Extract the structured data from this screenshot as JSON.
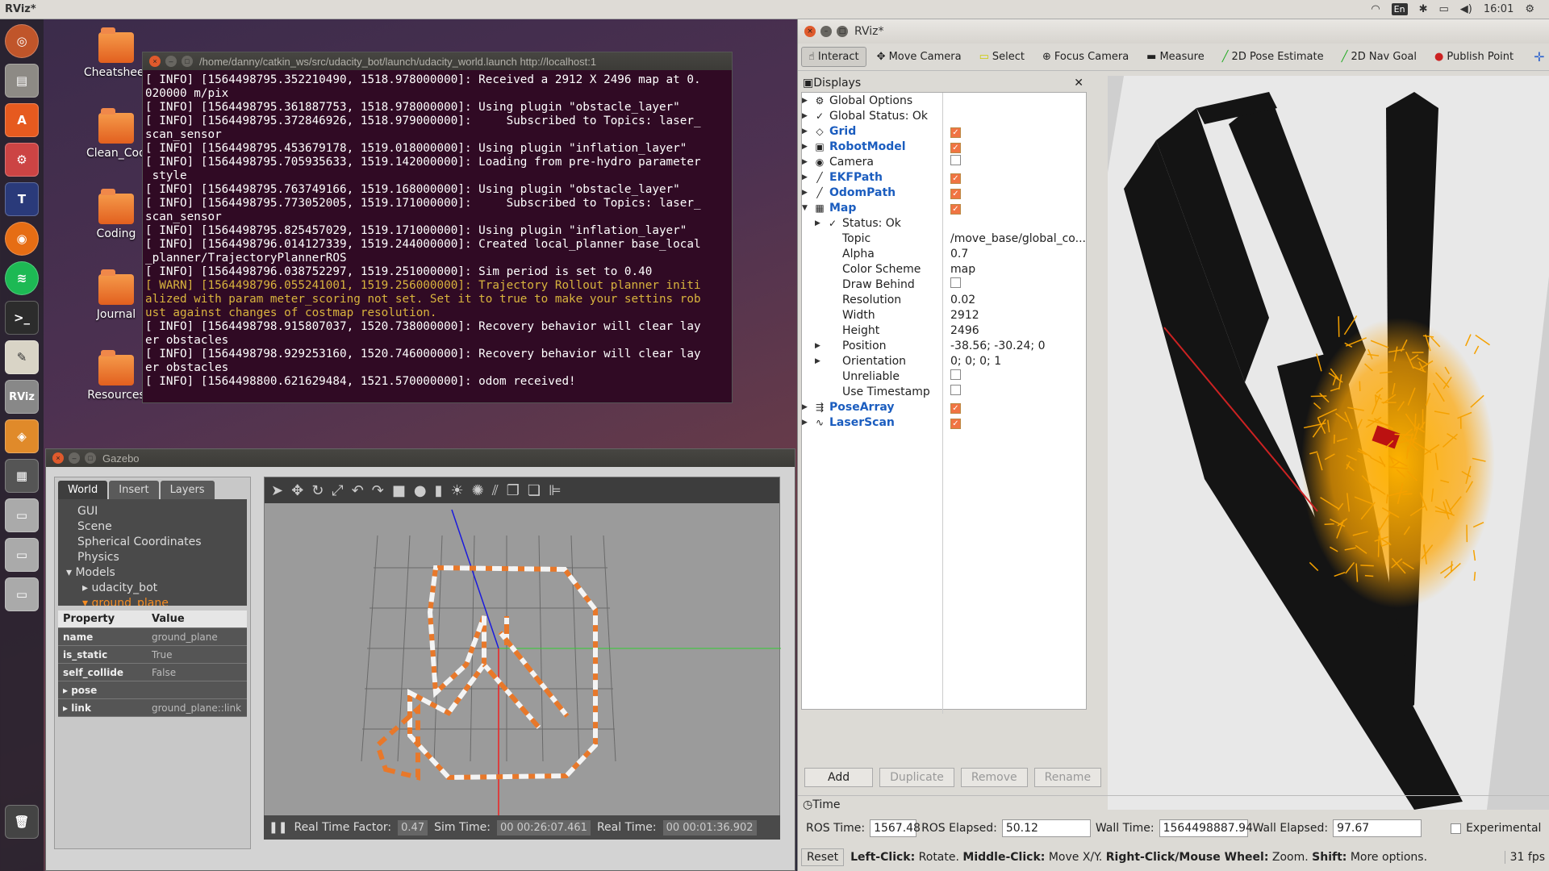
{
  "topbar": {
    "title": "RViz*",
    "lang": "En",
    "time": "16:01"
  },
  "desktop": {
    "items": [
      {
        "label": "Cheatsheet"
      },
      {
        "label": "Clean_Cod"
      },
      {
        "label": "Coding"
      },
      {
        "label": "Journal"
      },
      {
        "label": "Resources"
      }
    ]
  },
  "terminal": {
    "title": "/home/danny/catkin_ws/src/udacity_bot/launch/udacity_world.launch http://localhost:1",
    "lines": [
      {
        "text": "[ INFO] [1564498795.352210490, 1518.978000000]: Received a 2912 X 2496 map at 0.",
        "warn": false
      },
      {
        "text": "020000 m/pix",
        "warn": false
      },
      {
        "text": "[ INFO] [1564498795.361887753, 1518.978000000]: Using plugin \"obstacle_layer\"",
        "warn": false
      },
      {
        "text": "[ INFO] [1564498795.372846926, 1518.979000000]:     Subscribed to Topics: laser_",
        "warn": false
      },
      {
        "text": "scan_sensor",
        "warn": false
      },
      {
        "text": "[ INFO] [1564498795.453679178, 1519.018000000]: Using plugin \"inflation_layer\"",
        "warn": false
      },
      {
        "text": "[ INFO] [1564498795.705935633, 1519.142000000]: Loading from pre-hydro parameter",
        "warn": false
      },
      {
        "text": " style",
        "warn": false
      },
      {
        "text": "[ INFO] [1564498795.763749166, 1519.168000000]: Using plugin \"obstacle_layer\"",
        "warn": false
      },
      {
        "text": "[ INFO] [1564498795.773052005, 1519.171000000]:     Subscribed to Topics: laser_",
        "warn": false
      },
      {
        "text": "scan_sensor",
        "warn": false
      },
      {
        "text": "[ INFO] [1564498795.825457029, 1519.171000000]: Using plugin \"inflation_layer\"",
        "warn": false
      },
      {
        "text": "[ INFO] [1564498796.014127339, 1519.244000000]: Created local_planner base_local",
        "warn": false
      },
      {
        "text": "_planner/TrajectoryPlannerROS",
        "warn": false
      },
      {
        "text": "[ INFO] [1564498796.038752297, 1519.251000000]: Sim period is set to 0.40",
        "warn": false
      },
      {
        "text": "[ WARN] [1564498796.055241001, 1519.256000000]: Trajectory Rollout planner initi",
        "warn": true
      },
      {
        "text": "alized with param meter_scoring not set. Set it to true to make your settins rob",
        "warn": true
      },
      {
        "text": "ust against changes of costmap resolution.",
        "warn": true
      },
      {
        "text": "[ INFO] [1564498798.915807037, 1520.738000000]: Recovery behavior will clear lay",
        "warn": false
      },
      {
        "text": "er obstacles",
        "warn": false
      },
      {
        "text": "[ INFO] [1564498798.929253160, 1520.746000000]: Recovery behavior will clear lay",
        "warn": false
      },
      {
        "text": "er obstacles",
        "warn": false
      },
      {
        "text": "[ INFO] [1564498800.621629484, 1521.570000000]: odom received!",
        "warn": false
      }
    ]
  },
  "gazebo": {
    "title": "Gazebo",
    "tabs": [
      "World",
      "Insert",
      "Layers"
    ],
    "tree": [
      {
        "label": "GUI",
        "indent": 0,
        "sel": false
      },
      {
        "label": "Scene",
        "indent": 0,
        "sel": false
      },
      {
        "label": "Spherical Coordinates",
        "indent": 0,
        "sel": false
      },
      {
        "label": "Physics",
        "indent": 0,
        "sel": false
      },
      {
        "label": "▾ Models",
        "indent": -14,
        "sel": false
      },
      {
        "label": "▸ udacity_bot",
        "indent": 6,
        "sel": false
      },
      {
        "label": "▾ ground_plane",
        "indent": 6,
        "sel": true
      }
    ],
    "props": {
      "h_prop": "Property",
      "h_val": "Value",
      "rows": [
        {
          "k": "name",
          "v": "ground_plane"
        },
        {
          "k": "is_static",
          "v": "True"
        },
        {
          "k": "self_collide",
          "v": "False"
        },
        {
          "k": "▸ pose",
          "v": ""
        },
        {
          "k": "▸ link",
          "v": "ground_plane::link"
        }
      ]
    },
    "status": {
      "rtf_label": "Real Time Factor:",
      "rtf": "0.47",
      "sim_label": "Sim Time:",
      "sim": "00 00:26:07.461",
      "real_label": "Real Time:",
      "real": "00 00:01:36.902"
    }
  },
  "rviz": {
    "title": "RViz*",
    "tools": [
      "Interact",
      "Move Camera",
      "Select",
      "Focus Camera",
      "Measure",
      "2D Pose Estimate",
      "2D Nav Goal",
      "Publish Point"
    ],
    "displays_label": "Displays",
    "rows": [
      {
        "name": "Global Options",
        "val": "",
        "check": null,
        "blue": false,
        "lvl": 0,
        "icon": "⚙"
      },
      {
        "name": "Global Status: Ok",
        "val": "",
        "check": null,
        "blue": false,
        "lvl": 0,
        "icon": "✓"
      },
      {
        "name": "Grid",
        "val": "",
        "check": true,
        "blue": true,
        "lvl": 0,
        "icon": "◇"
      },
      {
        "name": "RobotModel",
        "val": "",
        "check": true,
        "blue": true,
        "lvl": 0,
        "icon": "▣"
      },
      {
        "name": "Camera",
        "val": "",
        "check": false,
        "blue": false,
        "lvl": 0,
        "icon": "◉"
      },
      {
        "name": "EKFPath",
        "val": "",
        "check": true,
        "blue": true,
        "lvl": 0,
        "icon": "╱"
      },
      {
        "name": "OdomPath",
        "val": "",
        "check": true,
        "blue": true,
        "lvl": 0,
        "icon": "╱"
      },
      {
        "name": "Map",
        "val": "",
        "check": true,
        "blue": true,
        "lvl": 0,
        "icon": "▦"
      },
      {
        "name": "Status: Ok",
        "val": "",
        "check": null,
        "blue": false,
        "lvl": 1,
        "icon": "✓"
      },
      {
        "name": "Topic",
        "val": "/move_base/global_co...",
        "check": null,
        "blue": false,
        "lvl": 1,
        "icon": ""
      },
      {
        "name": "Alpha",
        "val": "0.7",
        "check": null,
        "blue": false,
        "lvl": 1,
        "icon": ""
      },
      {
        "name": "Color Scheme",
        "val": "map",
        "check": null,
        "blue": false,
        "lvl": 1,
        "icon": ""
      },
      {
        "name": "Draw Behind",
        "val": "",
        "check": false,
        "blue": false,
        "lvl": 1,
        "icon": ""
      },
      {
        "name": "Resolution",
        "val": "0.02",
        "check": null,
        "blue": false,
        "lvl": 1,
        "icon": ""
      },
      {
        "name": "Width",
        "val": "2912",
        "check": null,
        "blue": false,
        "lvl": 1,
        "icon": ""
      },
      {
        "name": "Height",
        "val": "2496",
        "check": null,
        "blue": false,
        "lvl": 1,
        "icon": ""
      },
      {
        "name": "Position",
        "val": "-38.56; -30.24; 0",
        "check": null,
        "blue": false,
        "lvl": 1,
        "icon": ""
      },
      {
        "name": "Orientation",
        "val": "0; 0; 0; 1",
        "check": null,
        "blue": false,
        "lvl": 1,
        "icon": ""
      },
      {
        "name": "Unreliable",
        "val": "",
        "check": false,
        "blue": false,
        "lvl": 1,
        "icon": ""
      },
      {
        "name": "Use Timestamp",
        "val": "",
        "check": false,
        "blue": false,
        "lvl": 1,
        "icon": ""
      },
      {
        "name": "PoseArray",
        "val": "",
        "check": true,
        "blue": true,
        "lvl": 0,
        "icon": "⇶"
      },
      {
        "name": "LaserScan",
        "val": "",
        "check": true,
        "blue": true,
        "lvl": 0,
        "icon": "∿"
      }
    ],
    "buttons": {
      "add": "Add",
      "dup": "Duplicate",
      "rem": "Remove",
      "ren": "Rename"
    },
    "time": {
      "header": "Time",
      "ros_time_label": "ROS Time:",
      "ros_time": "1567.48",
      "ros_el_label": "ROS Elapsed:",
      "ros_el": "50.12",
      "wall_label": "Wall Time:",
      "wall": "1564498887.94",
      "wall_el_label": "Wall Elapsed:",
      "wall_el": "97.67",
      "exp": "Experimental"
    },
    "bottom": {
      "reset": "Reset",
      "h1": "Left-Click:",
      "t1": "Rotate.",
      "h2": "Middle-Click:",
      "t2": "Move X/Y.",
      "h3": "Right-Click/Mouse Wheel:",
      "t3": "Zoom.",
      "h4": "Shift:",
      "t4": "More options.",
      "fps": "31 fps"
    }
  }
}
